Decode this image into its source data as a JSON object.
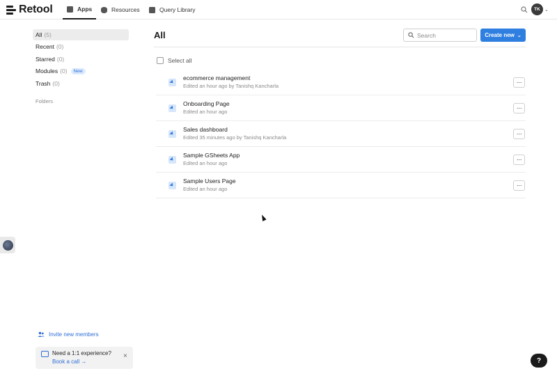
{
  "brand": {
    "name": "Retool"
  },
  "nav": {
    "tabs": [
      {
        "label": "Apps",
        "icon": "apps-icon",
        "active": true
      },
      {
        "label": "Resources",
        "icon": "database-icon",
        "active": false
      },
      {
        "label": "Query Library",
        "icon": "book-icon",
        "active": false
      }
    ],
    "user_initials": "TK"
  },
  "sidebar": {
    "items": [
      {
        "label": "All",
        "count": "(5)",
        "active": true
      },
      {
        "label": "Recent",
        "count": "(0)"
      },
      {
        "label": "Starred",
        "count": "(0)"
      },
      {
        "label": "Modules",
        "count": "(0)",
        "badge": "New"
      },
      {
        "label": "Trash",
        "count": "(0)"
      }
    ],
    "folders_label": "Folders",
    "invite_label": "Invite new members",
    "callout": {
      "title": "Need a 1:1 experience?",
      "link": "Book a call →"
    }
  },
  "main": {
    "title": "All",
    "search_placeholder": "Search",
    "create_label": "Create new",
    "select_all_label": "Select all",
    "apps": [
      {
        "name": "ecommerce management",
        "meta": "Edited an hour ago by Tanishq Kancharla"
      },
      {
        "name": "Onboarding Page",
        "meta": "Edited an hour ago"
      },
      {
        "name": "Sales dashboard",
        "meta": "Edited 35 minutes ago by Tanishq Kancharla"
      },
      {
        "name": "Sample GSheets App",
        "meta": "Edited an hour ago"
      },
      {
        "name": "Sample Users Page",
        "meta": "Edited an hour ago"
      }
    ],
    "more_label": "···"
  },
  "help_label": "?",
  "colors": {
    "accent": "#2f7fe0",
    "badge_bg": "#dbeafd"
  }
}
